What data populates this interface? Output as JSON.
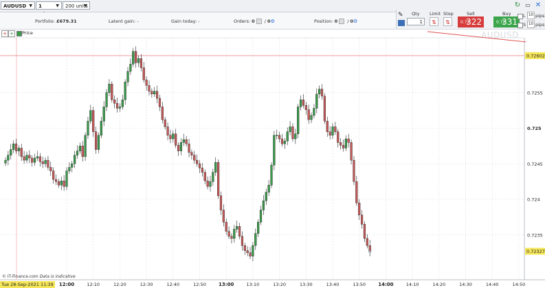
{
  "toolbar": {
    "instrument": "AUDUSD",
    "timeframe": "1 minute",
    "units": "200 units"
  },
  "info": {
    "portfolio_label": "Portfolio:",
    "portfolio_value": "£679.31",
    "latent_label": "Latent gain:",
    "latent_value": "-",
    "today_label": "Gain today:",
    "today_value": "-",
    "orders_label": "Orders:",
    "orders_value": "0",
    "orders_slash": "/",
    "orders_value2": "0",
    "position_label": "Position:",
    "position_value": "0",
    "position_slash": "/",
    "position_value2": "0"
  },
  "trade": {
    "qty_label": "Qty",
    "qty_value": "1",
    "limit_label": "Limit",
    "stop_label": "Stop",
    "sell_label": "Sell",
    "buy_label": "Buy",
    "sell_prefix": "0.72",
    "sell_big": "322",
    "buy_prefix": "0.72",
    "buy_big": "331",
    "l_label": "L",
    "s_label": "S",
    "pips_value_1": "10",
    "pips_value_2": "10",
    "pips_label": "pips"
  },
  "legend": {
    "price_label": "Price"
  },
  "watermark": "AUDUSD",
  "footer": {
    "copyright": "© IT-Finance.com",
    "indicative": "Data is indicative",
    "cursor_date": "Tue 28-Sep-2021 11:39"
  },
  "colors": {
    "up": "#3a9a4a",
    "down": "#c65a5a",
    "grid": "#d9dce1",
    "level_line": "#f08a8a",
    "price_tag": "#f5e65a"
  },
  "chart_data": {
    "type": "candlestick",
    "title": "",
    "ylabel": "",
    "xlabel": "",
    "ylim": [
      0.72295,
      0.72635
    ],
    "y_ticks": [
      0.7235,
      0.724,
      0.7245,
      0.725,
      0.7255
    ],
    "y_tick_labels": [
      "0.7235",
      "0.724",
      "0.7245",
      "0.725",
      "0.7255"
    ],
    "y_bold_tick": "0.725",
    "x_ticks": [
      "12:00",
      "12:10",
      "12:20",
      "12:30",
      "12:40",
      "12:50",
      "13:00",
      "13:10",
      "13:20",
      "13:30",
      "13:40",
      "13:50",
      "14:00",
      "14:10",
      "14:20",
      "14:30",
      "14:40",
      "14:50"
    ],
    "x_bold_ticks": [
      "12:00",
      "13:00",
      "14:00"
    ],
    "time_start": "11:37",
    "horizontal_level": 0.72602,
    "horizontal_level_label": "0.72602",
    "last_price": 0.72327,
    "last_price_label": "0.72327",
    "grid": true,
    "close_path": [
      0.72455,
      0.72462,
      0.7247,
      0.72478,
      0.72468,
      0.72472,
      0.7246,
      0.72455,
      0.72462,
      0.72458,
      0.72452,
      0.72458,
      0.7246,
      0.72453,
      0.7245,
      0.72455,
      0.72445,
      0.7244,
      0.72428,
      0.72425,
      0.7242,
      0.72426,
      0.72418,
      0.7244,
      0.72445,
      0.7245,
      0.72462,
      0.72468,
      0.72475,
      0.7246,
      0.7249,
      0.7251,
      0.72525,
      0.72495,
      0.7247,
      0.7249,
      0.7251,
      0.7253,
      0.7255,
      0.72562,
      0.7254,
      0.72535,
      0.72528,
      0.7253,
      0.7254,
      0.72565,
      0.7258,
      0.7259,
      0.72608,
      0.72592,
      0.72598,
      0.72585,
      0.72568,
      0.7256,
      0.72552,
      0.72548,
      0.72552,
      0.72542,
      0.7253,
      0.72512,
      0.72502,
      0.7249,
      0.72485,
      0.72492,
      0.72476,
      0.72468,
      0.7248,
      0.72484,
      0.72478,
      0.72466,
      0.72462,
      0.72455,
      0.7245,
      0.72444,
      0.72438,
      0.72426,
      0.72418,
      0.72425,
      0.72438,
      0.72452,
      0.72405,
      0.72385,
      0.72368,
      0.72355,
      0.72348,
      0.72345,
      0.72358,
      0.72362,
      0.72348,
      0.72335,
      0.72328,
      0.72325,
      0.7232,
      0.72335,
      0.72352,
      0.72368,
      0.72385,
      0.72398,
      0.7241,
      0.7242,
      0.72448,
      0.7249,
      0.7249,
      0.72485,
      0.72478,
      0.72482,
      0.72495,
      0.72502,
      0.72485,
      0.72492,
      0.7253,
      0.7254,
      0.72532,
      0.72526,
      0.72512,
      0.72518,
      0.72528,
      0.72548,
      0.72555,
      0.72545,
      0.7251,
      0.72495,
      0.7249,
      0.72502,
      0.72495,
      0.7248,
      0.72476,
      0.72472,
      0.72485,
      0.7248,
      0.72455,
      0.72425,
      0.72395,
      0.72378,
      0.72365,
      0.72345,
      0.72335,
      0.72327
    ]
  }
}
